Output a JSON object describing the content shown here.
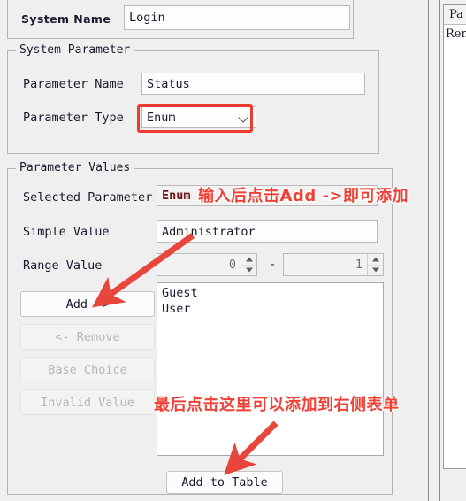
{
  "system_name_group": {
    "label": "System Name",
    "value": "Login"
  },
  "system_parameter_group": {
    "title": "System Parameter",
    "name_label": "Parameter Name",
    "name_value": "Status",
    "type_label": "Parameter Type",
    "type_value": "Enum",
    "type_chevron_icon": "chevron-down-icon"
  },
  "parameter_values_group": {
    "title": "Parameter Values",
    "selected_parameter_label": "Selected Parameter",
    "selected_parameter_value": "Enum",
    "simple_value_label": "Simple Value",
    "simple_value": "Administrator",
    "range_value_label": "Range Value",
    "range_min": "0",
    "range_max": "1",
    "range_separator": "-",
    "spinner_up_icon": "spinner-up-icon",
    "spinner_down_icon": "spinner-down-icon",
    "buttons": [
      {
        "label": "Add ->",
        "enabled": true
      },
      {
        "label": "<- Remove",
        "enabled": false
      },
      {
        "label": "Base Choice",
        "enabled": false
      },
      {
        "label": "Invalid Value",
        "enabled": false
      }
    ],
    "value_list": [
      "Guest",
      "User"
    ],
    "add_to_table_label": "Add to Table"
  },
  "side_panel": {
    "column_header": "Pa",
    "first_cell": "Rem"
  },
  "annotations": {
    "top": "输入后点击Add ->即可添加",
    "bottom": "最后点击这里可以添加到右侧表单",
    "arrow_color": "#e8453c",
    "highlight_color": "#ee3b2f"
  }
}
